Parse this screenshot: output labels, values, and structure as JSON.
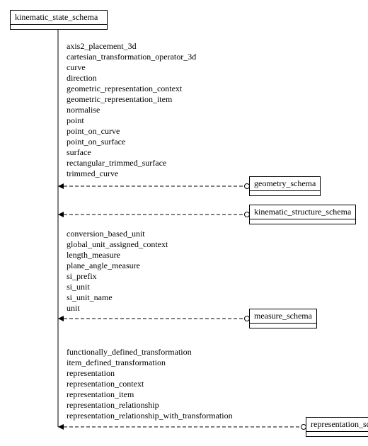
{
  "root": {
    "name": "kinematic_state_schema"
  },
  "refs": {
    "geometry": {
      "name": "geometry_schema",
      "attrs": [
        "axis2_placement_3d",
        "cartesian_transformation_operator_3d",
        "curve",
        "direction",
        "geometric_representation_context",
        "geometric_representation_item",
        "normalise",
        "point",
        "point_on_curve",
        "point_on_surface",
        "surface",
        "rectangular_trimmed_surface",
        "trimmed_curve"
      ]
    },
    "kinematic_structure": {
      "name": "kinematic_structure_schema",
      "attrs": []
    },
    "measure": {
      "name": "measure_schema",
      "attrs": [
        "conversion_based_unit",
        "global_unit_assigned_context",
        "length_measure",
        "plane_angle_measure",
        "si_prefix",
        "si_unit",
        "si_unit_name",
        "unit"
      ]
    },
    "representation": {
      "name": "representation_schema",
      "attrs": [
        "functionally_defined_transformation",
        "item_defined_transformation",
        "representation",
        "representation_context",
        "representation_item",
        "representation_relationship",
        "representation_relationship_with_transformation"
      ]
    }
  }
}
